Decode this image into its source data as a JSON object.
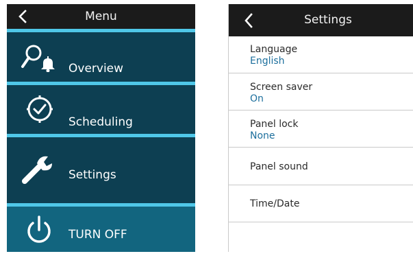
{
  "menu": {
    "title": "Menu",
    "items": [
      {
        "label": "Overview",
        "icon": "search-bell-icon"
      },
      {
        "label": "Scheduling",
        "icon": "clock-icon"
      },
      {
        "label": "Settings",
        "icon": "wrench-icon"
      },
      {
        "label": "TURN OFF",
        "icon": "power-icon"
      }
    ],
    "colors": {
      "header": "#1b1b1b",
      "item_bg": "#0d3f52",
      "turnoff_bg": "#12657f",
      "separator": "#4fc7e8"
    }
  },
  "settings": {
    "title": "Settings",
    "rows": [
      {
        "label": "Language",
        "value": "English"
      },
      {
        "label": "Screen saver",
        "value": "On"
      },
      {
        "label": "Panel lock",
        "value": "None"
      },
      {
        "label": "Panel sound"
      },
      {
        "label": "Time/Date"
      }
    ],
    "colors": {
      "value_text": "#1d6f9d"
    }
  }
}
